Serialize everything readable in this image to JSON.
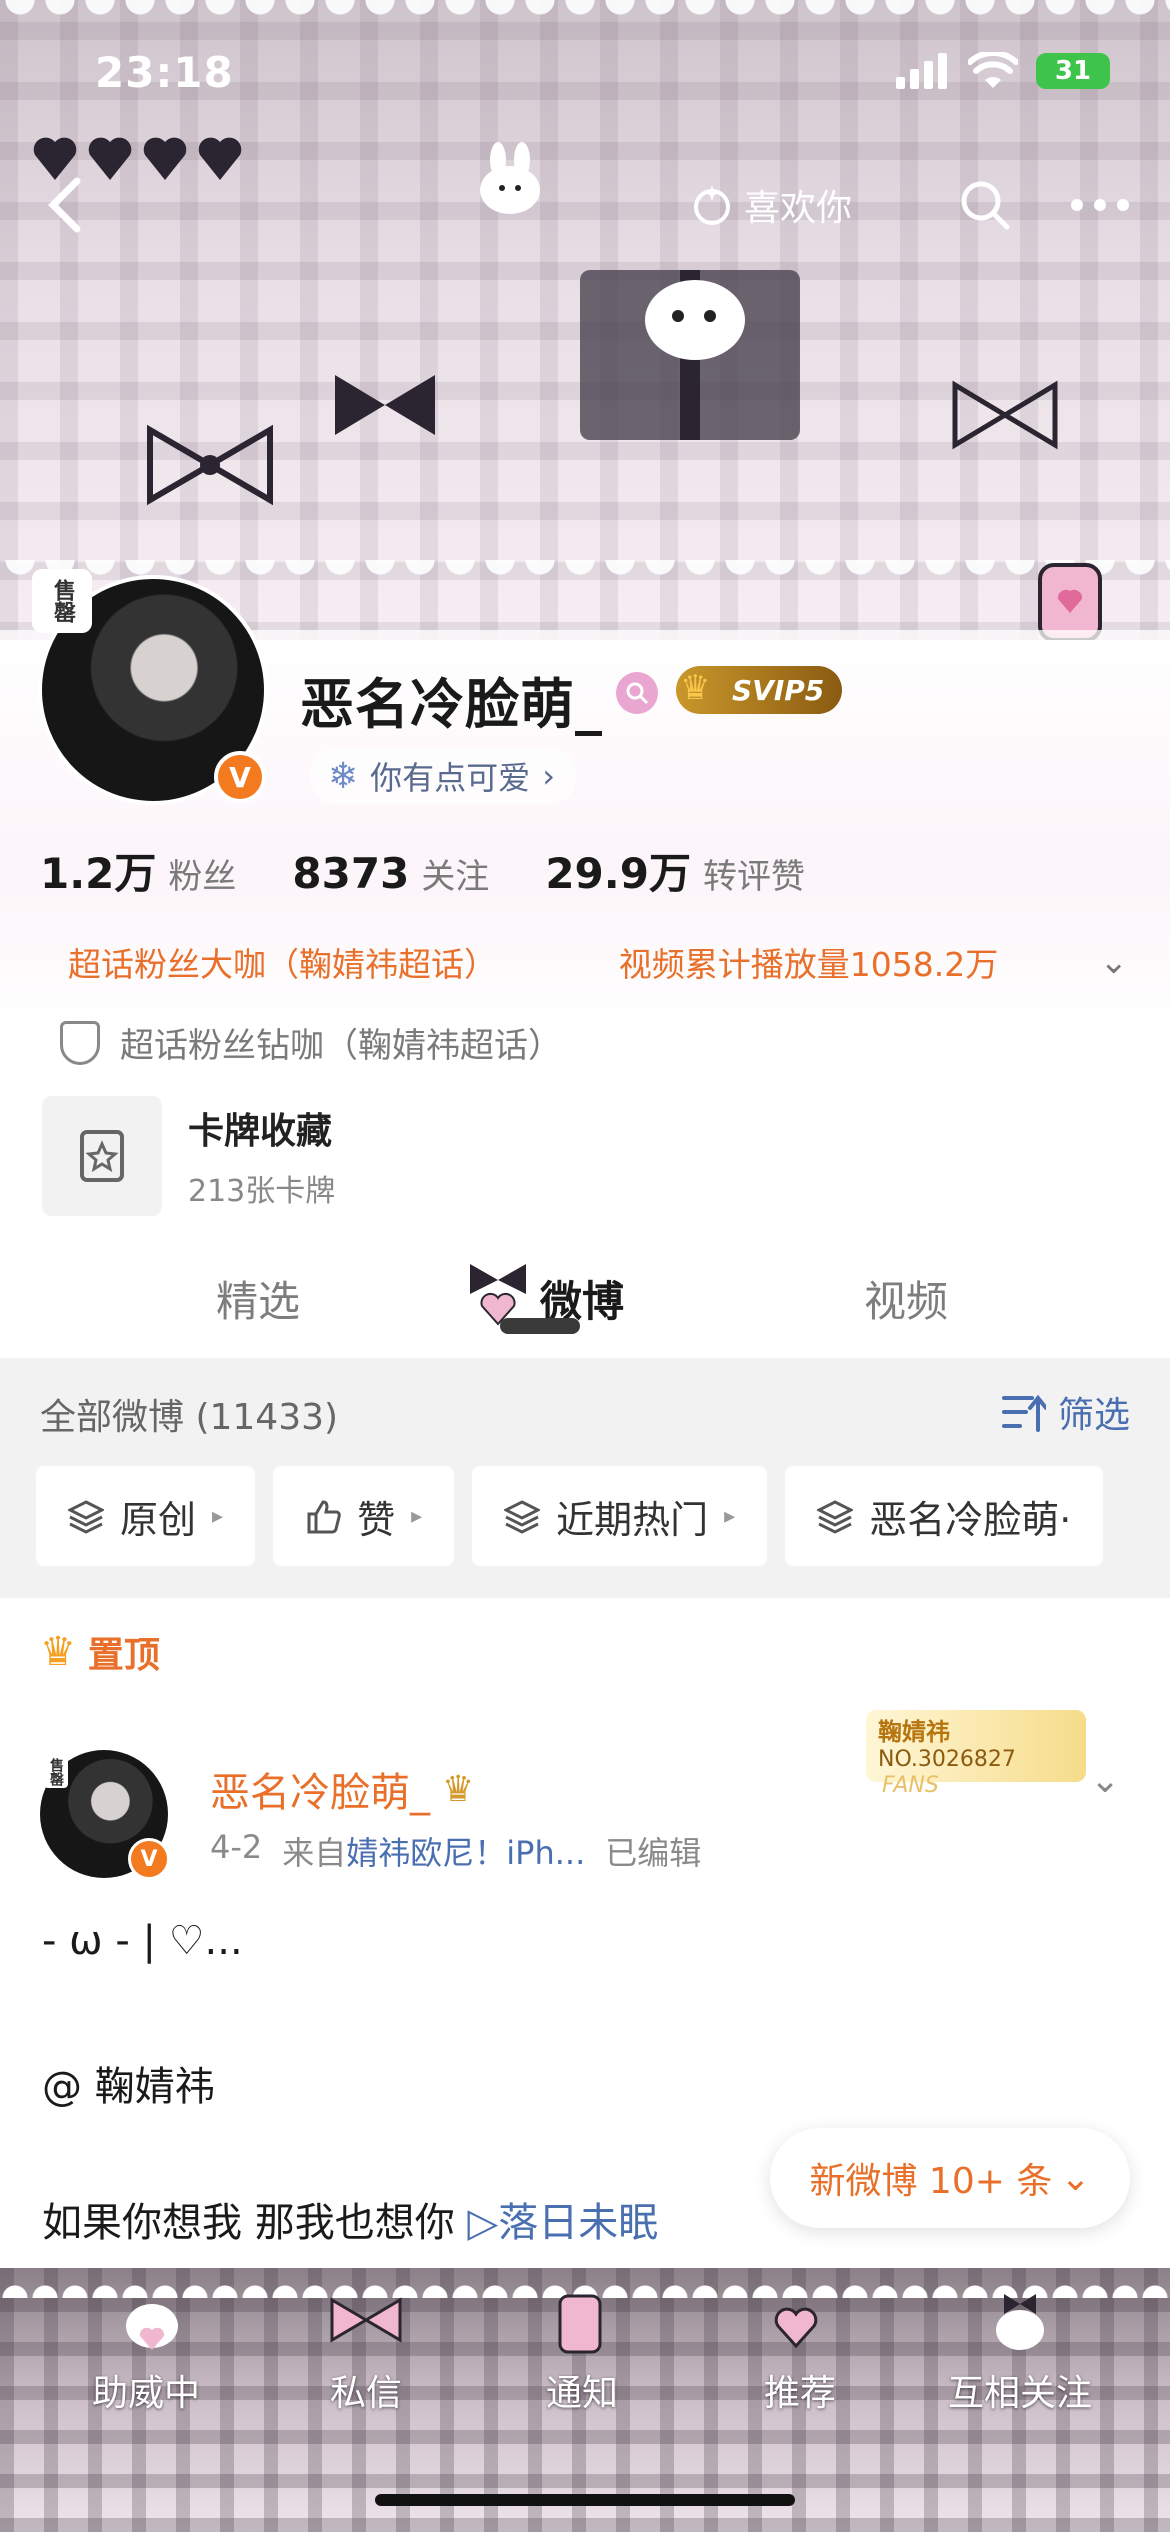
{
  "status_bar": {
    "time": "23:18",
    "battery": "31"
  },
  "top_nav": {
    "like_label": "喜欢你"
  },
  "profile": {
    "avatar_sticker": "售罄",
    "username": "恶名冷脸萌_",
    "svip": "SVIP5",
    "bio": "你有点可爱",
    "stats": [
      {
        "num": "1.2万",
        "label": "粉丝"
      },
      {
        "num": "8373",
        "label": "关注"
      },
      {
        "num": "29.9万",
        "label": "转评赞"
      }
    ],
    "honor_1": "超话粉丝大咖（鞠婧祎超话）",
    "honor_2": "视频累计播放量1058.2万",
    "diamond": "超话粉丝钻咖（鞠婧祎超话）",
    "card_title": "卡牌收藏",
    "card_sub": "213张卡牌"
  },
  "tabs": [
    "精选",
    "微博",
    "视频"
  ],
  "feed": {
    "all_label": "全部微博 (11433)",
    "filter_label": "筛选",
    "chips": [
      "原创",
      "赞",
      "近期热门",
      "恶名冷脸萌·"
    ]
  },
  "post": {
    "pinned_label": "置顶",
    "avatar_sticker": "售罄",
    "author": "恶名冷脸萌_",
    "date": "4-2",
    "source_prefix": "来自",
    "source": "婧祎欧尼！iPh...",
    "edited": "已编辑",
    "fan_badge_name": "鞠婧祎",
    "fan_badge_no": "NO.3026827",
    "fan_badge_tag": "FANS",
    "line1": "- ω - | ♡...",
    "line2": "@ 鞠婧祎",
    "line3_text": "如果你想我 那我也想你",
    "line3_link": "▷落日未眠"
  },
  "new_weibo": "新微博 10+ 条",
  "bottom_bar": [
    "助威中",
    "私信",
    "通知",
    "推荐",
    "互相关注"
  ],
  "colors": {
    "accent": "#e8702a",
    "link": "#4a6fb0",
    "vip_orange": "#f47a1f"
  }
}
